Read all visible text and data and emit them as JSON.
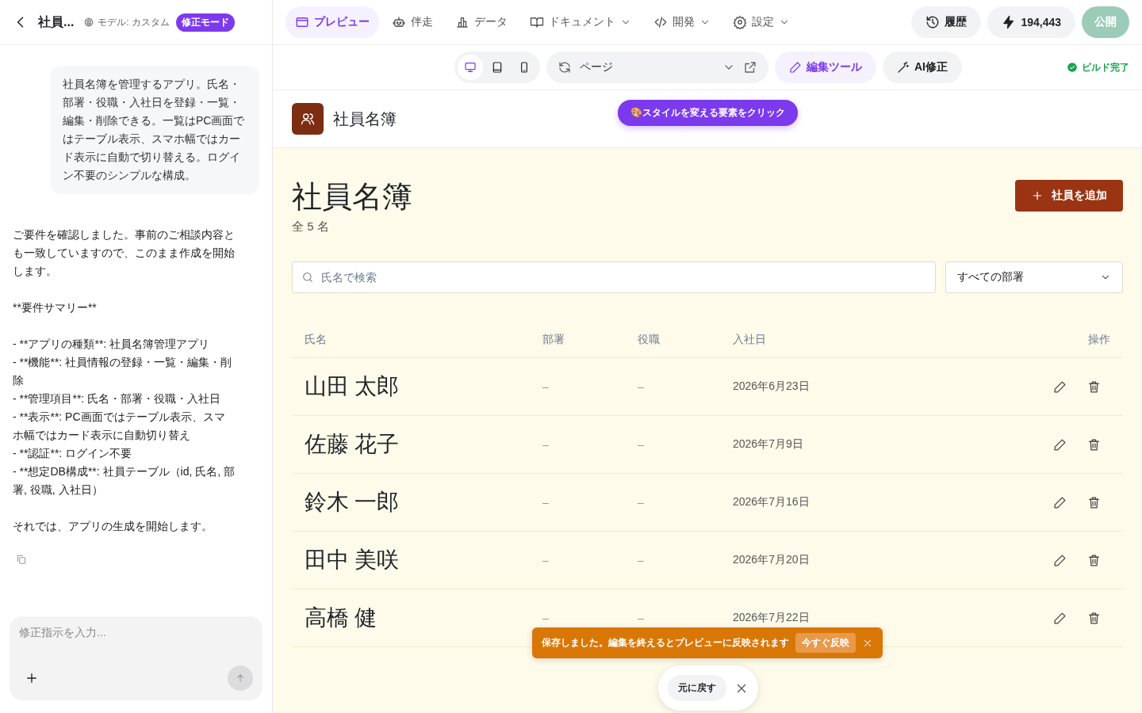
{
  "header": {
    "title": "社員...",
    "model": "モデル: カスタム",
    "mode_badge": "修正モード"
  },
  "chat": {
    "user_message": "社員名簿を管理するアプリ。氏名・部署・役職・入社日を登録・一覧・編集・削除できる。一覧はPC画面ではテーブル表示、スマホ幅ではカード表示に自動で切り替える。ログイン不要のシンプルな構成。",
    "assistant": [
      {
        "kind": "paragraph",
        "text": "ご要件を確認しました。事前のご相談内容とも一致していますので、このまま作成を開始します。"
      },
      {
        "kind": "paragraph",
        "text": "**要件サマリー**"
      },
      {
        "kind": "list",
        "items": [
          "- **アプリの種類**: 社員名簿管理アプリ",
          "- **機能**: 社員情報の登録・一覧・編集・削除",
          "- **管理項目**: 氏名・部署・役職・入社日",
          "- **表示**: PC画面ではテーブル表示、スマホ幅ではカード表示に自動切り替え",
          "- **認証**: ログイン不要",
          "- **想定DB構成**: 社員テーブル（id, 氏名, 部署, 役職, 入社日）"
        ]
      },
      {
        "kind": "paragraph",
        "text": "それでは、アプリの生成を開始します。"
      }
    ],
    "input": {
      "placeholder": "修正指示を入力..."
    }
  },
  "nav": {
    "tabs": [
      {
        "label": "プレビュー",
        "dropdown": false,
        "selected": true
      },
      {
        "label": "伴走",
        "dropdown": false,
        "selected": false
      },
      {
        "label": "データ",
        "dropdown": false,
        "selected": false
      },
      {
        "label": "ドキュメント",
        "dropdown": true,
        "selected": false
      },
      {
        "label": "開発",
        "dropdown": true,
        "selected": false
      },
      {
        "label": "設定",
        "dropdown": true,
        "selected": false
      }
    ],
    "history": "履歴",
    "credits": "194,443",
    "publish": "公開"
  },
  "toolbar": {
    "devices": [
      {
        "kind": "desktop",
        "selected": true
      },
      {
        "kind": "tablet",
        "selected": false
      },
      {
        "kind": "phone",
        "selected": false
      }
    ],
    "page_select": "ページ",
    "edit_tool": {
      "label": "編集ツール",
      "selected": true
    },
    "ai_fix": "AI修正",
    "build_status": "ビルド完了"
  },
  "preview": {
    "app_name": "社員名簿",
    "hint": "🎨スタイルを変える要素をクリック",
    "heading": "社員名簿",
    "count": "全 5 名",
    "add_button": "社員を追加",
    "search": {
      "placeholder": "氏名で検索"
    },
    "department_filter": "すべての部署",
    "table": {
      "columns": [
        "氏名",
        "部署",
        "役職",
        "入社日",
        "操作"
      ],
      "rows": [
        {
          "name": "山田 太郎",
          "department": "–",
          "role": "–",
          "joined": "2026年6月23日"
        },
        {
          "name": "佐藤 花子",
          "department": "–",
          "role": "–",
          "joined": "2026年7月9日"
        },
        {
          "name": "鈴木 一郎",
          "department": "–",
          "role": "–",
          "joined": "2026年7月16日"
        },
        {
          "name": "田中 美咲",
          "department": "–",
          "role": "–",
          "joined": "2026年7月20日"
        },
        {
          "name": "高橋 健",
          "department": "–",
          "role": "–",
          "joined": "2026年7月22日"
        }
      ]
    }
  },
  "toast": {
    "message": "保存しました。編集を終えるとプレビューに反映されます",
    "action": "今すぐ反映"
  },
  "undo": {
    "label": "元に戻す"
  }
}
